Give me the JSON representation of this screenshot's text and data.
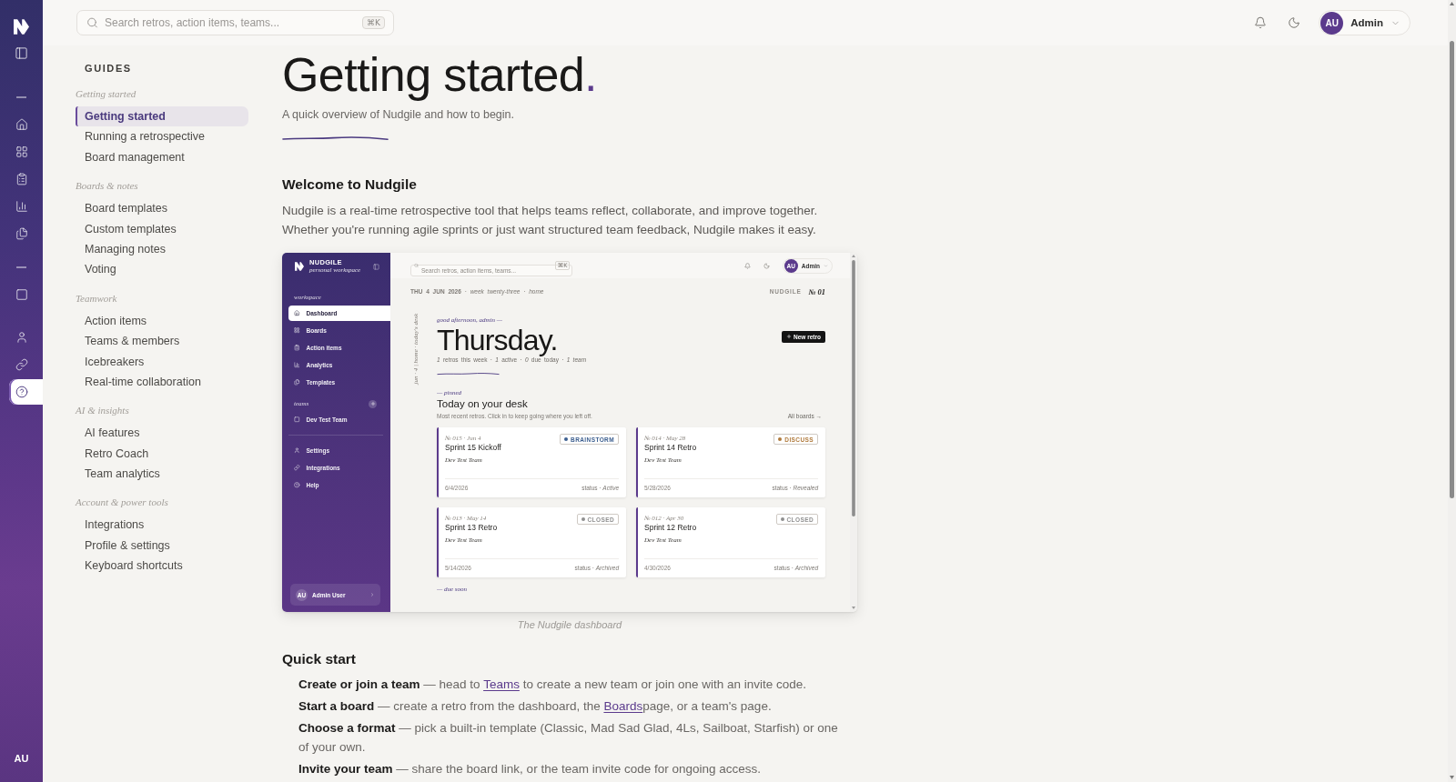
{
  "rail": {
    "groups": [
      [
        {
          "kind": "home",
          "selected": false
        },
        {
          "kind": "boards",
          "selected": false
        },
        {
          "kind": "actions",
          "selected": false
        },
        {
          "kind": "analytics",
          "selected": false
        },
        {
          "kind": "templates",
          "selected": false
        }
      ],
      [
        {
          "kind": "team",
          "selected": false
        }
      ],
      [
        {
          "kind": "profile",
          "selected": false
        },
        {
          "kind": "integrations",
          "selected": false
        },
        {
          "kind": "help",
          "selected": true
        }
      ]
    ],
    "avatar": "AU"
  },
  "topbar": {
    "search": {
      "placeholder": "Search retros, action items, teams...",
      "shortcut": "⌘K"
    },
    "user": {
      "initials": "AU",
      "name": "Admin"
    }
  },
  "guides": {
    "title": "GUIDES",
    "sections": [
      {
        "title": "Getting started",
        "items": [
          {
            "label": "Getting started",
            "selected": true
          },
          {
            "label": "Running a retrospective",
            "selected": false
          },
          {
            "label": "Board management",
            "selected": false
          }
        ]
      },
      {
        "title": "Boards & notes",
        "items": [
          {
            "label": "Board templates",
            "selected": false
          },
          {
            "label": "Custom templates",
            "selected": false
          },
          {
            "label": "Managing notes",
            "selected": false
          },
          {
            "label": "Voting",
            "selected": false
          }
        ]
      },
      {
        "title": "Teamwork",
        "items": [
          {
            "label": "Action items",
            "selected": false
          },
          {
            "label": "Teams & members",
            "selected": false
          },
          {
            "label": "Icebreakers",
            "selected": false
          },
          {
            "label": "Real-time collaboration",
            "selected": false
          }
        ]
      },
      {
        "title": "AI & insights",
        "items": [
          {
            "label": "AI features",
            "selected": false
          },
          {
            "label": "Retro Coach",
            "selected": false
          },
          {
            "label": "Team analytics",
            "selected": false
          }
        ]
      },
      {
        "title": "Account & power tools",
        "items": [
          {
            "label": "Integrations",
            "selected": false
          },
          {
            "label": "Profile & settings",
            "selected": false
          },
          {
            "label": "Keyboard shortcuts",
            "selected": false
          }
        ]
      }
    ]
  },
  "article": {
    "title": "Getting started",
    "title_mark": ".",
    "subtitle": "A quick overview of Nudgile and how to begin.",
    "intro": {
      "heading": "Welcome to Nudgile",
      "text": "Nudgile is a real-time retrospective tool that helps teams reflect, collaborate, and improve together. Whether you're running agile sprints or just want structured team feedback, Nudgile makes it easy."
    },
    "figure": {
      "caption": "The Nudgile dashboard",
      "screen": {
        "brand": "NUDGILE",
        "brand_note": "personal workspace",
        "nav": [
          {
            "title": "workspace",
            "items": [
              {
                "kind": "home",
                "label": "Dashboard",
                "selected": true
              },
              {
                "kind": "boards",
                "label": "Boards",
                "selected": false
              },
              {
                "kind": "actions",
                "label": "Action items",
                "selected": false
              },
              {
                "kind": "analytics",
                "label": "Analytics",
                "selected": false
              },
              {
                "kind": "templates",
                "label": "Templates",
                "selected": false
              }
            ]
          },
          {
            "title": "teams",
            "items": [
              {
                "kind": "team",
                "label": "Dev Test Team",
                "selected": false
              }
            ]
          },
          {
            "items": [
              {
                "kind": "profile",
                "label": "Settings",
                "selected": false
              },
              {
                "kind": "integrations",
                "label": "Integrations",
                "selected": false
              },
              {
                "kind": "help",
                "label": "Help",
                "selected": false
              }
            ]
          }
        ],
        "account": {
          "initials": "AU",
          "name": "Admin User"
        },
        "search": {
          "placeholder": "Search retros, action items, teams...",
          "shortcut": "⌘K"
        },
        "user": {
          "initials": "AU",
          "name": "Admin"
        },
        "dateline": "**THU 4 JUN 2026** · *week twenty-three* · *home*",
        "issue_brand": "NUDGILE",
        "issue_number": "№ 01",
        "margin_note": "jun · 4 | home · today's desk",
        "greeting": "good afternoon, admin —",
        "day": "Thursday.",
        "new_button": "New retro",
        "stats": "*1* retros this week · *1* active · *0* due today · *1 team*",
        "pinned_label": "— pinned",
        "desk_title": "Today on your desk",
        "desk_note": "Most recent retros. Click in to keep going where you left off.",
        "all_link": "All boards →",
        "cards": [
          {
            "meta": "№ 015 · Jun 4",
            "title": "Sprint 15 Kickoff",
            "team": "Dev Test Team",
            "date": "6/4/2026",
            "status": "status · *Active*",
            "stage": "BRAINSTORM",
            "color": "#3d5f8f"
          },
          {
            "meta": "№ 014 · May 28",
            "title": "Sprint 14 Retro",
            "team": "Dev Test Team",
            "date": "5/28/2026",
            "status": "status · *Revealed*",
            "stage": "DISCUSS",
            "color": "#b07a3c"
          },
          {
            "meta": "№ 013 · May 14",
            "title": "Sprint 13 Retro",
            "team": "Dev Test Team",
            "date": "5/14/2026",
            "status": "status · *Archived*",
            "stage": "CLOSED",
            "color": "#8f8f8f"
          },
          {
            "meta": "№ 012 · Apr 30",
            "title": "Sprint 12 Retro",
            "team": "Dev Test Team",
            "date": "4/30/2026",
            "status": "status · *Archived*",
            "stage": "CLOSED",
            "color": "#8f8f8f"
          }
        ],
        "due_label": "— due soon"
      }
    },
    "quick_start": {
      "heading": "Quick start",
      "steps": [
        {
          "term": "Create or join a team",
          "before": "— head to ",
          "link": "Teams",
          "after": " to create a new team or join one with an invite code."
        },
        {
          "term": "Start a board",
          "before": "— create a retro from the dashboard, the ",
          "link": "Boards",
          "after": "page, or a team's page."
        },
        {
          "term": "Choose a format",
          "before": "— pick a built-in template (Classic, Mad Sad Glad, 4Ls, Sailboat, Starfish) or one of your own."
        },
        {
          "term": "Invite your team",
          "before": "— share the board link, or the team invite code for ongoing access."
        }
      ]
    }
  }
}
